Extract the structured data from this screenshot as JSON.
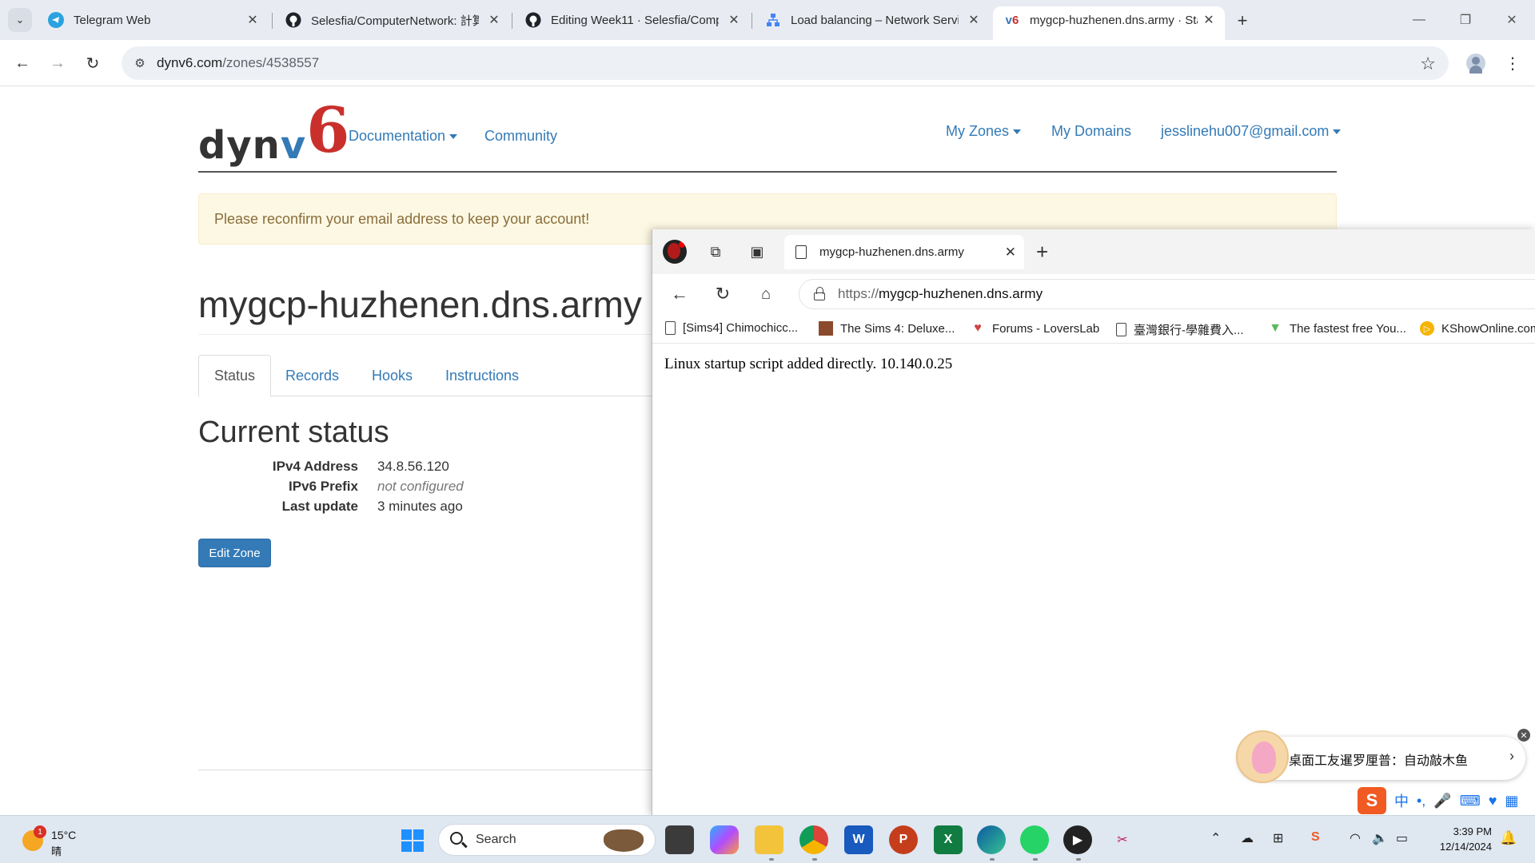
{
  "browser": {
    "tabs": [
      {
        "title": "Telegram Web",
        "icon": "telegram-icon"
      },
      {
        "title": "Selesfia/ComputerNetwork: 計算",
        "icon": "github-icon"
      },
      {
        "title": "Editing Week11 · Selesfia/Comp",
        "icon": "github-icon"
      },
      {
        "title": "Load balancing – Network Servi",
        "icon": "gcp-network-icon"
      },
      {
        "title": "mygcp-huzhenen.dns.army · Sta",
        "icon": "dynv6-icon",
        "favicon_text": "v6",
        "active": true
      }
    ],
    "url_host": "dynv6.com",
    "url_path": "/zones/4538557"
  },
  "site": {
    "logo": {
      "d": "dyn",
      "v": "v",
      "six": "6"
    },
    "nav": {
      "documentation": "Documentation",
      "community": "Community",
      "my_zones": "My Zones",
      "my_domains": "My Domains",
      "account": "jesslinehu007@gmail.com"
    },
    "alert": "Please reconfirm your email address to keep your account!",
    "zone_title": "mygcp-huzhenen.dns.army",
    "tabs": [
      "Status",
      "Records",
      "Hooks",
      "Instructions"
    ],
    "status_heading": "Current status",
    "status": {
      "ipv4_label": "IPv4 Address",
      "ipv4_value": "34.8.56.120",
      "ipv6_label": "IPv6 Prefix",
      "ipv6_value": "not configured",
      "update_label": "Last update",
      "update_value": "3 minutes ago"
    },
    "edit_button": "Edit Zone"
  },
  "edge": {
    "tab_title": "mygcp-huzhenen.dns.army",
    "url_scheme": "https://",
    "url_host": "mygcp-huzhenen.dns.army",
    "favorites": [
      {
        "label": "[Sims4] Chimochicc...",
        "icon": "document-icon"
      },
      {
        "label": "The Sims 4: Deluxe...",
        "icon": "sims-icon"
      },
      {
        "label": "Forums - LoversLab",
        "icon": "loverslab-icon"
      },
      {
        "label": "臺灣銀行-學雜費入...",
        "icon": "document-icon"
      },
      {
        "label": "The fastest free You...",
        "icon": "download-icon"
      },
      {
        "label": "KShowOnline.com",
        "icon": "kshow-icon"
      }
    ],
    "content": "Linux startup script added directly. 10.140.0.25"
  },
  "toast": {
    "text": "桌面工友暹罗厘普：自动敲木鱼"
  },
  "ime": {
    "logo": "S",
    "lang": "中"
  },
  "taskbar": {
    "weather_badge": "1",
    "temperature": "15°C",
    "condition": "晴",
    "search_label": "Search",
    "apps": [
      "task-view",
      "copilot",
      "file-explorer",
      "chrome",
      "word",
      "powerpoint",
      "excel",
      "edge",
      "whatsapp",
      "media-player",
      "snipping-tool"
    ],
    "time": "3:39 PM",
    "date": "12/14/2024"
  }
}
